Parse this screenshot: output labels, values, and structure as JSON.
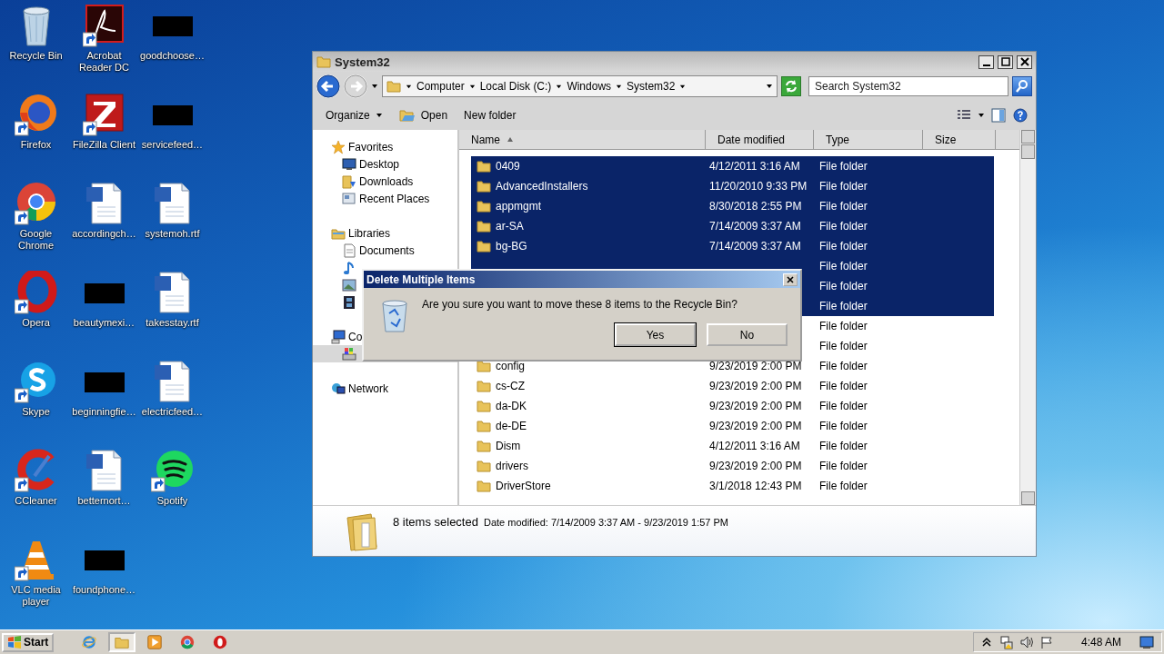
{
  "desktop_icons": [
    {
      "label": "Recycle Bin",
      "kind": "recycle-bin",
      "shortcut": false
    },
    {
      "label": "Acrobat Reader DC",
      "kind": "acrobat",
      "shortcut": true
    },
    {
      "label": "goodchoose…",
      "kind": "redacted",
      "shortcut": false
    },
    {
      "label": "Firefox",
      "kind": "firefox",
      "shortcut": true
    },
    {
      "label": "FileZilla Client",
      "kind": "filezilla",
      "shortcut": true
    },
    {
      "label": "servicefeed…",
      "kind": "redacted",
      "shortcut": false
    },
    {
      "label": "Google Chrome",
      "kind": "chrome",
      "shortcut": true
    },
    {
      "label": "accordingch…",
      "kind": "word",
      "shortcut": false
    },
    {
      "label": "systemoh.rtf",
      "kind": "word",
      "shortcut": false
    },
    {
      "label": "Opera",
      "kind": "opera",
      "shortcut": true
    },
    {
      "label": "beautymexi…",
      "kind": "redacted",
      "shortcut": false
    },
    {
      "label": "takesstay.rtf",
      "kind": "word",
      "shortcut": false
    },
    {
      "label": "Skype",
      "kind": "skype",
      "shortcut": true
    },
    {
      "label": "beginningfie…",
      "kind": "redacted",
      "shortcut": false
    },
    {
      "label": "electricfeed…",
      "kind": "word",
      "shortcut": false
    },
    {
      "label": "CCleaner",
      "kind": "ccleaner",
      "shortcut": true
    },
    {
      "label": "betternort…",
      "kind": "word",
      "shortcut": false
    },
    {
      "label": "Spotify",
      "kind": "spotify",
      "shortcut": true
    },
    {
      "label": "VLC media player",
      "kind": "vlc",
      "shortcut": true
    },
    {
      "label": "foundphone…",
      "kind": "redacted",
      "shortcut": false
    }
  ],
  "explorer": {
    "title": "System32",
    "breadcrumb": [
      "Computer",
      "Local Disk (C:)",
      "Windows",
      "System32"
    ],
    "search": {
      "placeholder": "Search System32"
    },
    "toolbar": [
      {
        "label": "Organize",
        "kind": "menu"
      },
      {
        "label": "Open",
        "kind": "open"
      },
      {
        "label": "New folder",
        "kind": "plain"
      }
    ],
    "nav": [
      {
        "label": "Favorites",
        "kind": "star",
        "selected": false,
        "children": [
          {
            "label": "Desktop",
            "kind": "desktop",
            "selected": false
          },
          {
            "label": "Downloads",
            "kind": "downloads",
            "selected": false
          },
          {
            "label": "Recent Places",
            "kind": "recent",
            "selected": false
          }
        ]
      },
      {
        "label": "Libraries",
        "kind": "libraries",
        "selected": false,
        "children": [
          {
            "label": "Documents",
            "kind": "documents",
            "selected": false
          },
          {
            "kind": "music",
            "selected": false
          },
          {
            "kind": "pictures",
            "selected": false
          },
          {
            "kind": "videos",
            "selected": false
          }
        ]
      },
      {
        "label": "Co",
        "kind": "computer",
        "selected": false,
        "children": [
          {
            "kind": "drive",
            "selected": true
          }
        ]
      },
      {
        "label": "Network",
        "kind": "network",
        "selected": false
      }
    ],
    "columns": [
      {
        "label": "Name",
        "sorted": true
      },
      {
        "label": "Date modified",
        "sorted": false
      },
      {
        "label": "Type",
        "sorted": false
      },
      {
        "label": "Size",
        "sorted": false
      }
    ],
    "rows": [
      {
        "name": "0409",
        "date": "4/12/2011 3:16 AM",
        "type": "File folder",
        "selected": true
      },
      {
        "name": "AdvancedInstallers",
        "date": "11/20/2010 9:33 PM",
        "type": "File folder",
        "selected": true
      },
      {
        "name": "appmgmt",
        "date": "8/30/2018 2:55 PM",
        "type": "File folder",
        "selected": true
      },
      {
        "name": "ar-SA",
        "date": "7/14/2009 3:37 AM",
        "type": "File folder",
        "selected": true
      },
      {
        "name": "bg-BG",
        "date": "7/14/2009 3:37 AM",
        "type": "File folder",
        "selected": true
      },
      {
        "type": "File folder",
        "selected": true
      },
      {
        "type": "File folder",
        "selected": true
      },
      {
        "type": "File folder",
        "selected": true
      },
      {
        "type": "File folder",
        "selected": false
      },
      {
        "type": "File folder",
        "selected": false
      },
      {
        "name": "config",
        "date": "9/23/2019 2:00 PM",
        "type": "File folder",
        "selected": false
      },
      {
        "name": "cs-CZ",
        "date": "9/23/2019 2:00 PM",
        "type": "File folder",
        "selected": false
      },
      {
        "name": "da-DK",
        "date": "9/23/2019 2:00 PM",
        "type": "File folder",
        "selected": false
      },
      {
        "name": "de-DE",
        "date": "9/23/2019 2:00 PM",
        "type": "File folder",
        "selected": false
      },
      {
        "name": "Dism",
        "date": "4/12/2011 3:16 AM",
        "type": "File folder",
        "selected": false
      },
      {
        "name": "drivers",
        "date": "9/23/2019 2:00 PM",
        "type": "File folder",
        "selected": false
      },
      {
        "name": "DriverStore",
        "date": "3/1/2018 12:43 PM",
        "type": "File folder",
        "selected": false
      }
    ],
    "status": {
      "count": "8 items selected",
      "detail": "Date modified: 7/14/2009 3:37 AM - 9/23/2019 1:57 PM"
    }
  },
  "dialog": {
    "title": "Delete Multiple Items",
    "message": "Are you sure you want to move these 8 items to the Recycle Bin?",
    "buttons": [
      {
        "label": "Yes",
        "default": true
      },
      {
        "label": "No",
        "default": false
      }
    ]
  },
  "taskbar": {
    "start": "Start",
    "apps": [
      {
        "kind": "ie",
        "active": false
      },
      {
        "kind": "explorer",
        "active": true
      },
      {
        "kind": "media",
        "active": false
      },
      {
        "kind": "chrome",
        "active": false
      },
      {
        "kind": "opera",
        "active": false
      }
    ],
    "tray": [
      {
        "kind": "chevron"
      },
      {
        "kind": "network"
      },
      {
        "kind": "speaker"
      },
      {
        "kind": "flag"
      }
    ],
    "clock": "4:48 AM"
  }
}
